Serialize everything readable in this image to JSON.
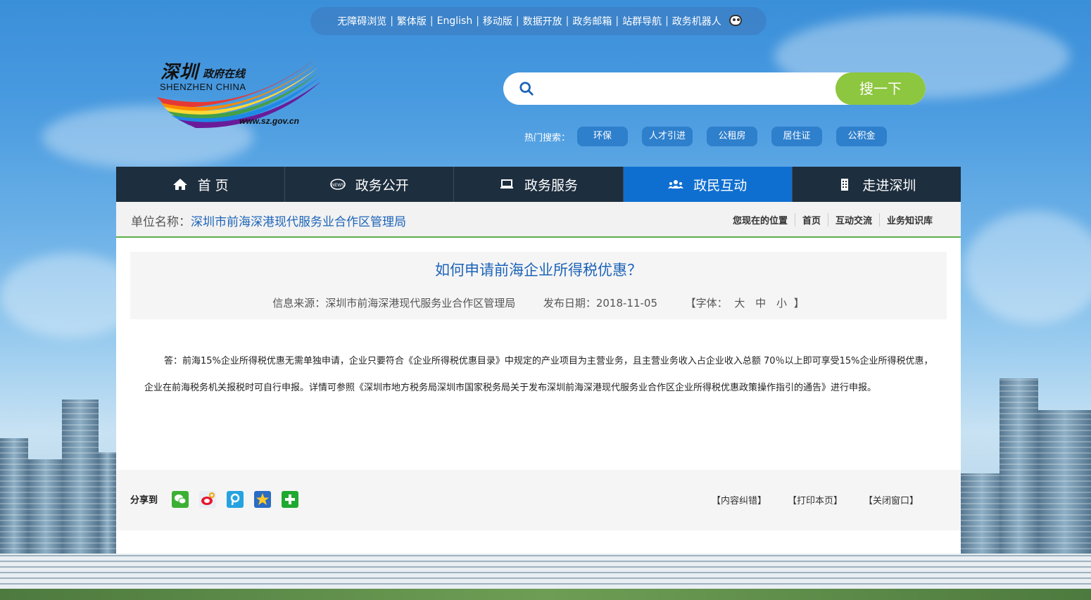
{
  "topbar": {
    "links": [
      "无障碍浏览",
      "繁体版",
      "English",
      "移动版",
      "数据开放",
      "政务邮箱",
      "站群导航",
      "政务机器人"
    ]
  },
  "logo": {
    "cn_main": "深圳",
    "cn_sub": "政府在线",
    "en": "SHENZHEN CHINA",
    "url": "www.sz.gov.cn"
  },
  "search": {
    "placeholder": "",
    "button_label": "搜一下",
    "hot_label": "热门搜索：",
    "hot_tags": [
      "环保",
      "人才引进",
      "公租房",
      "居住证",
      "公积金"
    ]
  },
  "nav": {
    "items": [
      {
        "label": "首 页",
        "icon": "home-icon"
      },
      {
        "label": "政务公开",
        "icon": "news-icon"
      },
      {
        "label": "政务服务",
        "icon": "monitor-icon"
      },
      {
        "label": "政民互动",
        "icon": "users-icon"
      },
      {
        "label": "走进深圳",
        "icon": "building-icon"
      }
    ],
    "active_index": 3,
    "active_color": "#0f6fd0"
  },
  "unit": {
    "label": "单位名称：",
    "name": "深圳市前海深港现代服务业合作区管理局"
  },
  "breadcrumb": [
    "您现在的位置",
    "首页",
    "互动交流",
    "业务知识库"
  ],
  "article": {
    "title": "如何申请前海企业所得税优惠？",
    "source_label": "信息来源：",
    "source": "深圳市前海深港现代服务业合作区管理局",
    "date_label": "发布日期：",
    "date": "2018-11-05",
    "font_label": "【字体：",
    "font_sizes": [
      "大",
      "中",
      "小"
    ],
    "font_close": "】",
    "body": "答：前海15%企业所得税优惠无需单独申请，企业只要符合《企业所得税优惠目录》中规定的产业项目为主营业务，且主营业务收入占企业收入总额 70％以上即可享受15%企业所得税优惠，企业在前海税务机关报税时可自行申报。详情可参照《深圳市地方税务局深圳市国家税务局关于发布深圳前海深港现代服务业合作区企业所得税优惠政策操作指引的通告》进行申报。"
  },
  "share": {
    "label": "分享到",
    "icons": [
      "wechat-icon",
      "weibo-icon",
      "tencent-weibo-icon",
      "qzone-icon",
      "more-share-icon"
    ]
  },
  "actions": [
    "【内容纠错】",
    "【打印本页】",
    "【关闭窗口】"
  ]
}
